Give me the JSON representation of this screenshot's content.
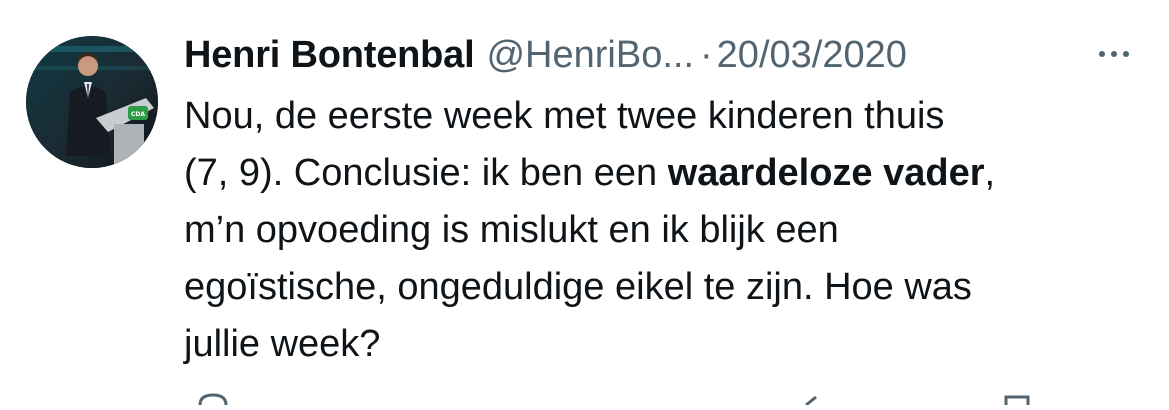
{
  "tweet": {
    "author_name": "Henri Bontenbal",
    "handle": "@HenriBo...",
    "separator": "·",
    "date": "20/03/2020",
    "text_lines": [
      {
        "parts": [
          {
            "t": "Nou, de eerste week met twee kinderen thuis",
            "bold": false
          }
        ]
      },
      {
        "parts": [
          {
            "t": "(7, 9). Conclusie: ik ben een ",
            "bold": false
          },
          {
            "t": "waardeloze vader",
            "bold": true
          },
          {
            "t": ",",
            "bold": false
          }
        ]
      },
      {
        "parts": [
          {
            "t": "m’n opvoeding is mislukt en ik blijk een",
            "bold": false
          }
        ]
      },
      {
        "parts": [
          {
            "t": "egoïstische, ongeduldige eikel te zijn. Hoe was",
            "bold": false
          }
        ]
      },
      {
        "parts": [
          {
            "t": "jullie week?",
            "bold": false
          }
        ]
      }
    ],
    "avatar_badge": "CDA"
  },
  "icons": {
    "more": "more-dots-icon",
    "reply": "reply-icon",
    "retweet": "retweet-icon",
    "like": "like-icon",
    "share": "share-icon"
  },
  "colors": {
    "text": "#0f1419",
    "secondary": "#536471",
    "cda_green": "#2e9b45"
  }
}
